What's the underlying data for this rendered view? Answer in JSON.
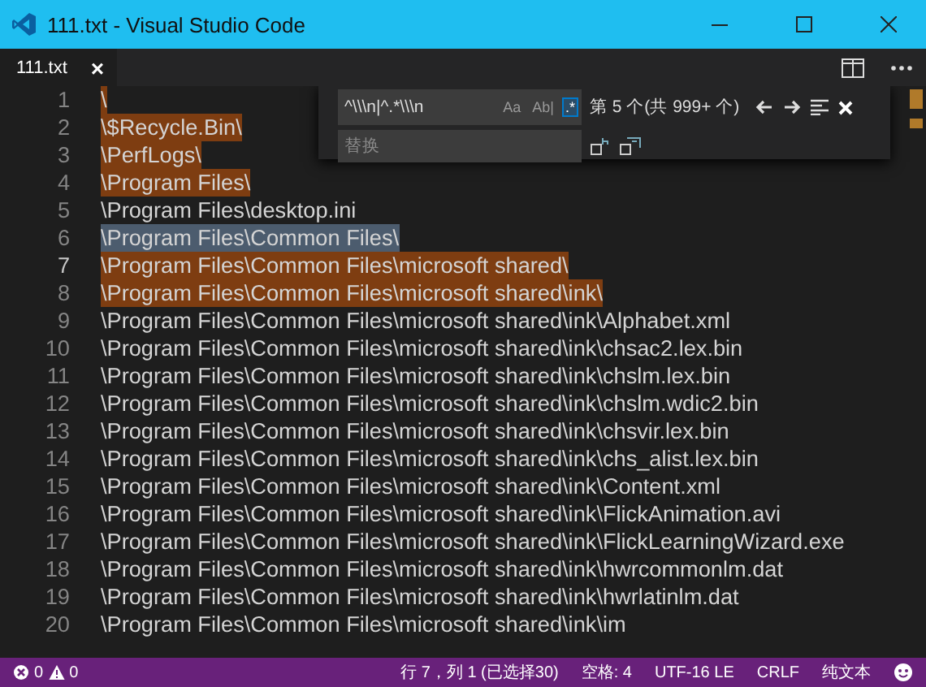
{
  "window": {
    "title": "111.txt - Visual Studio Code"
  },
  "tabs": [
    {
      "label": "111.txt",
      "selected": true,
      "close": "×"
    }
  ],
  "find_widget": {
    "find_value": "^\\\\\\n|^.*\\\\\\n",
    "options": [
      {
        "label": "Aa",
        "selected": false
      },
      {
        "label": "Ab|",
        "selected": false
      },
      {
        "label": ".*",
        "selected": true
      }
    ],
    "result": "第 5 个(共 999+ 个)",
    "replace_placeholder": "替换"
  },
  "lines": [
    {
      "number": "1",
      "text": "\\",
      "matched": true,
      "selected": false
    },
    {
      "number": "2",
      "text": "\\$Recycle.Bin\\",
      "matched": true,
      "selected": false
    },
    {
      "number": "3",
      "text": "\\PerfLogs\\",
      "matched": true,
      "selected": false
    },
    {
      "number": "4",
      "text": "\\Program Files\\",
      "matched": true,
      "selected": false
    },
    {
      "number": "5",
      "text": "\\Program Files\\desktop.ini",
      "matched": false,
      "selected": false
    },
    {
      "number": "6",
      "text": "\\Program Files\\Common Files\\",
      "matched": false,
      "selected": true
    },
    {
      "number": "7",
      "text": "\\Program Files\\Common Files\\microsoft shared\\",
      "matched": true,
      "selected": false
    },
    {
      "number": "8",
      "text": "\\Program Files\\Common Files\\microsoft shared\\ink\\",
      "matched": true,
      "selected": false
    },
    {
      "number": "9",
      "text": "\\Program Files\\Common Files\\microsoft shared\\ink\\Alphabet.xml",
      "matched": false,
      "selected": false
    },
    {
      "number": "10",
      "text": "\\Program Files\\Common Files\\microsoft shared\\ink\\chsac2.lex.bin",
      "matched": false,
      "selected": false
    },
    {
      "number": "11",
      "text": "\\Program Files\\Common Files\\microsoft shared\\ink\\chslm.lex.bin",
      "matched": false,
      "selected": false
    },
    {
      "number": "12",
      "text": "\\Program Files\\Common Files\\microsoft shared\\ink\\chslm.wdic2.bin",
      "matched": false,
      "selected": false
    },
    {
      "number": "13",
      "text": "\\Program Files\\Common Files\\microsoft shared\\ink\\chsvir.lex.bin",
      "matched": false,
      "selected": false
    },
    {
      "number": "14",
      "text": "\\Program Files\\Common Files\\microsoft shared\\ink\\chs_alist.lex.bin",
      "matched": false,
      "selected": false
    },
    {
      "number": "15",
      "text": "\\Program Files\\Common Files\\microsoft shared\\ink\\Content.xml",
      "matched": false,
      "selected": false
    },
    {
      "number": "16",
      "text": "\\Program Files\\Common Files\\microsoft shared\\ink\\FlickAnimation.avi",
      "matched": false,
      "selected": false
    },
    {
      "number": "17",
      "text": "\\Program Files\\Common Files\\microsoft shared\\ink\\FlickLearningWizard.exe",
      "matched": false,
      "selected": false
    },
    {
      "number": "18",
      "text": "\\Program Files\\Common Files\\microsoft shared\\ink\\hwrcommonlm.dat",
      "matched": false,
      "selected": false
    },
    {
      "number": "19",
      "text": "\\Program Files\\Common Files\\microsoft shared\\ink\\hwrlatinlm.dat",
      "matched": false,
      "selected": false
    },
    {
      "number": "20",
      "text": "\\Program Files\\Common Files\\microsoft shared\\ink\\im",
      "matched": false,
      "selected": false
    }
  ],
  "status_bar": {
    "errors": "0",
    "warnings": "0",
    "position": "行 7，列 1 (已选择30)",
    "indent": "空格: 4",
    "encoding": "UTF-16 LE",
    "eol": "CRLF",
    "language": "纯文本"
  }
}
